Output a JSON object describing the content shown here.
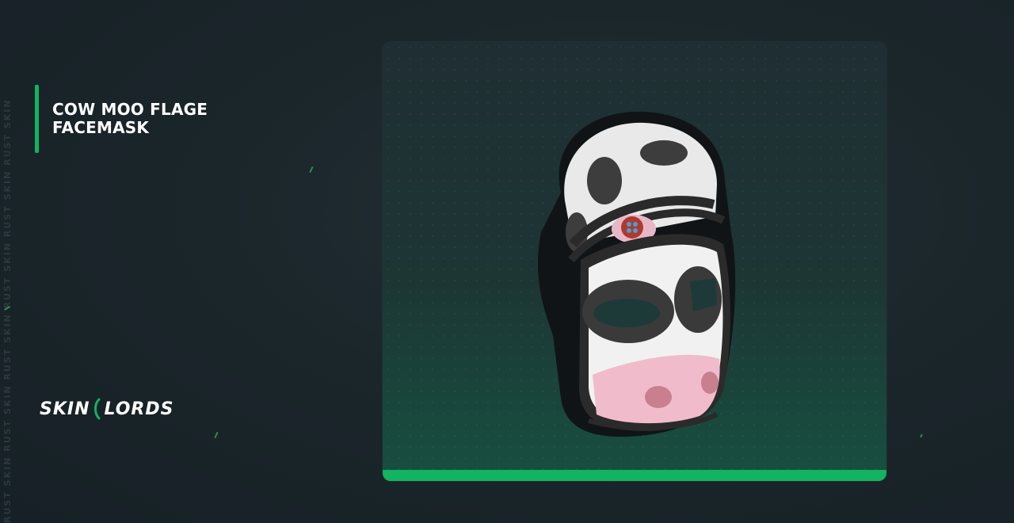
{
  "watermark": "RUST SKIN RUST SKIN RUST SKIN RUST SKIN RUST SKIN RUST SKIN",
  "item": {
    "title": "COW MOO FLAGE FACEMASK"
  },
  "brand": {
    "left": "SKIN",
    "right": "LORDS",
    "accent_color": "#12b361"
  },
  "colors": {
    "background": "#1b262b",
    "card": "#1f2e33",
    "accent": "#12b361"
  }
}
